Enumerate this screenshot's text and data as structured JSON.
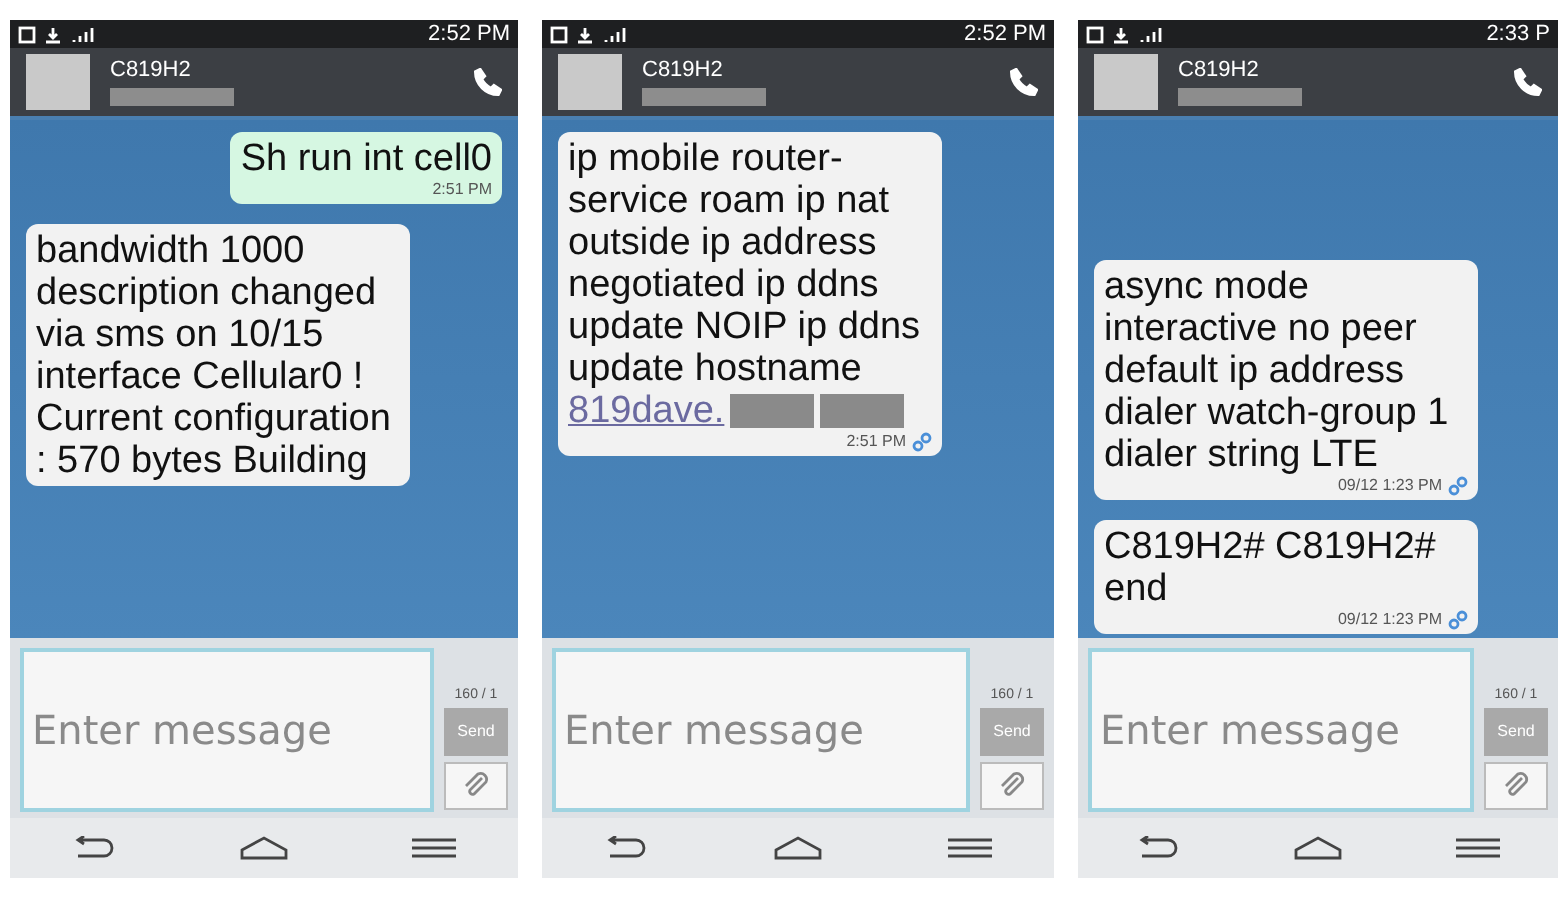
{
  "screens": [
    {
      "status_time": "2:52 PM",
      "contact": {
        "name": "C819H2"
      },
      "scrolled_to_end": false,
      "messages": [
        {
          "sent": true,
          "text": "Sh run int cell0",
          "time": "2:51 PM",
          "linked": false
        },
        {
          "sent": false,
          "text": "bandwidth 1000 description changed via sms on 10/15 interface Cellular0 ! Current configuration : 570 bytes Building",
          "linked": false
        }
      ],
      "input": {
        "placeholder": "Enter message",
        "counter": "160 / 1",
        "send": "Send"
      }
    },
    {
      "status_time": "2:52 PM",
      "contact": {
        "name": "C819H2"
      },
      "scrolled_to_end": false,
      "messages": [
        {
          "sent": false,
          "text": "ip mobile router-service roam ip nat outside ip address negotiated ip ddns update NOIP ip ddns update hostname",
          "link": "819dave.",
          "link_redacted": true,
          "time": "2:51 PM",
          "linked": true
        }
      ],
      "input": {
        "placeholder": "Enter message",
        "counter": "160 / 1",
        "send": "Send"
      }
    },
    {
      "status_time": "2:33 P",
      "contact": {
        "name": "C819H2"
      },
      "scrolled_to_end": true,
      "messages": [
        {
          "sent": false,
          "text": "async mode interactive no peer default ip address dialer watch-group 1 dialer string LTE",
          "time": "09/12 1:23 PM",
          "linked": true
        },
        {
          "sent": false,
          "text": "C819H2# C819H2# end",
          "time": "09/12 1:23 PM",
          "linked": true
        }
      ],
      "input": {
        "placeholder": "Enter message",
        "counter": "160 / 1",
        "send": "Send"
      }
    }
  ]
}
